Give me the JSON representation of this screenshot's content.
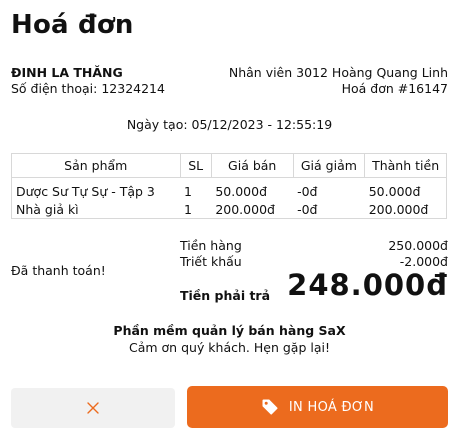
{
  "header": {
    "title": "Hoá đơn"
  },
  "customer": {
    "name": "ĐINH LA THĂNG",
    "phone": "Số điện thoại: 12324214"
  },
  "invoice": {
    "staff": "Nhân viên 3012 Hoàng Quang Linh",
    "number": "Hoá đơn #16147",
    "created": "Ngày tạo: 05/12/2023 - 12:55:19"
  },
  "table": {
    "headers": [
      "Sản phẩm",
      "SL",
      "Giá bán",
      "Giá giảm",
      "Thành tiền"
    ],
    "rows": [
      [
        "Dược Sư Tự Sự - Tập 3",
        "1",
        "50.000đ",
        "-0đ",
        "50.000đ"
      ],
      [
        "Nhà giả kì",
        "1",
        "200.000đ",
        "-0đ",
        "200.000đ"
      ]
    ]
  },
  "summary": {
    "paid_label": "Đã thanh toán!",
    "subtotal_label": "Tiền hàng",
    "subtotal_value": "250.000đ",
    "discount_label": "Triết khấu",
    "discount_value": "-2.000đ",
    "total_label": "Tiền phải trả",
    "total_value": "248.000đ"
  },
  "footer": {
    "brand": "Phần mềm quản lý bán hàng SaX",
    "thanks": "Cảm ơn quý khách. Hẹn gặp lại!"
  },
  "actions": {
    "close_icon": "close-icon",
    "print_icon": "tag-icon",
    "print_label": "IN HOÁ ĐƠN"
  },
  "colors": {
    "accent": "#ec6b1e",
    "secondary_button": "#f1f1f1",
    "table_border": "#d8d8d8"
  }
}
